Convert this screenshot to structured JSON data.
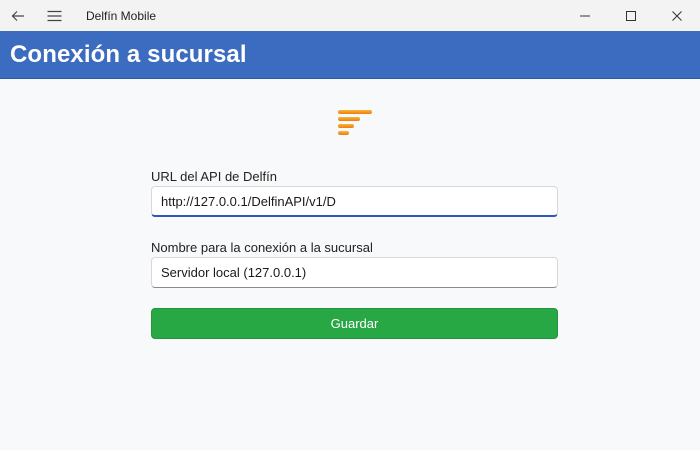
{
  "window": {
    "app_title": "Delfín Mobile",
    "icons": [
      "back-arrow-icon",
      "hamburger-menu-icon",
      "minimize-icon",
      "maximize-icon",
      "close-icon"
    ]
  },
  "header": {
    "title": "Conexión a sucursal",
    "color": "#3b6cbf"
  },
  "logo": {
    "icon": "delfin-logo-icon",
    "color": "#f39a1e"
  },
  "form": {
    "api_url": {
      "label": "URL del API de Delfín",
      "value": "http://127.0.0.1/DelfinAPI/v1/D"
    },
    "connection_name": {
      "label": "Nombre para la conexión a la sucursal",
      "value": "Servidor local (127.0.0.1)"
    },
    "save_button": {
      "label": "Guardar",
      "color": "#28a745"
    }
  }
}
